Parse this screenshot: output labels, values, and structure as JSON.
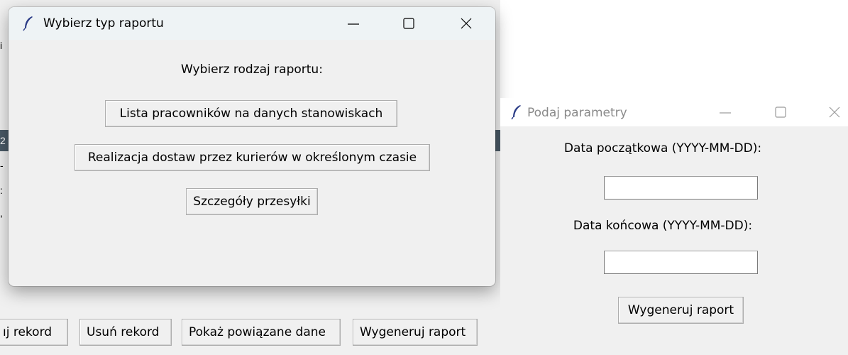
{
  "background_app": {
    "edge_texts": [
      "i",
      "2",
      "-",
      ":",
      ","
    ],
    "buttons": [
      "ıj rekord",
      "Usuń rekord",
      "Pokaż powiązane dane",
      "Wygeneruj raport"
    ]
  },
  "dialog_report_type": {
    "title": "Wybierz typ raportu",
    "prompt": "Wybierz rodzaj raportu:",
    "buttons": [
      "Lista pracowników na danych stanowiskach",
      "Realizacja dostaw przez kurierów w określonym czasie",
      "Szczegóły przesyłki"
    ]
  },
  "dialog_parameters": {
    "title": "Podaj parametry",
    "start_label": "Data początkowa (YYYY-MM-DD):",
    "start_value": "",
    "end_label": "Data końcowa (YYYY-MM-DD):",
    "end_value": "",
    "generate_button": "Wygeneruj raport"
  },
  "colors": {
    "dialog_bg": "#f0f0f0",
    "titlebar_active": "#eef3f5",
    "titlebar_inactive": "#ffffff",
    "background_strip": "#4a5a66"
  },
  "icons": [
    "feather-icon",
    "minimize-icon",
    "maximize-icon",
    "close-icon"
  ]
}
